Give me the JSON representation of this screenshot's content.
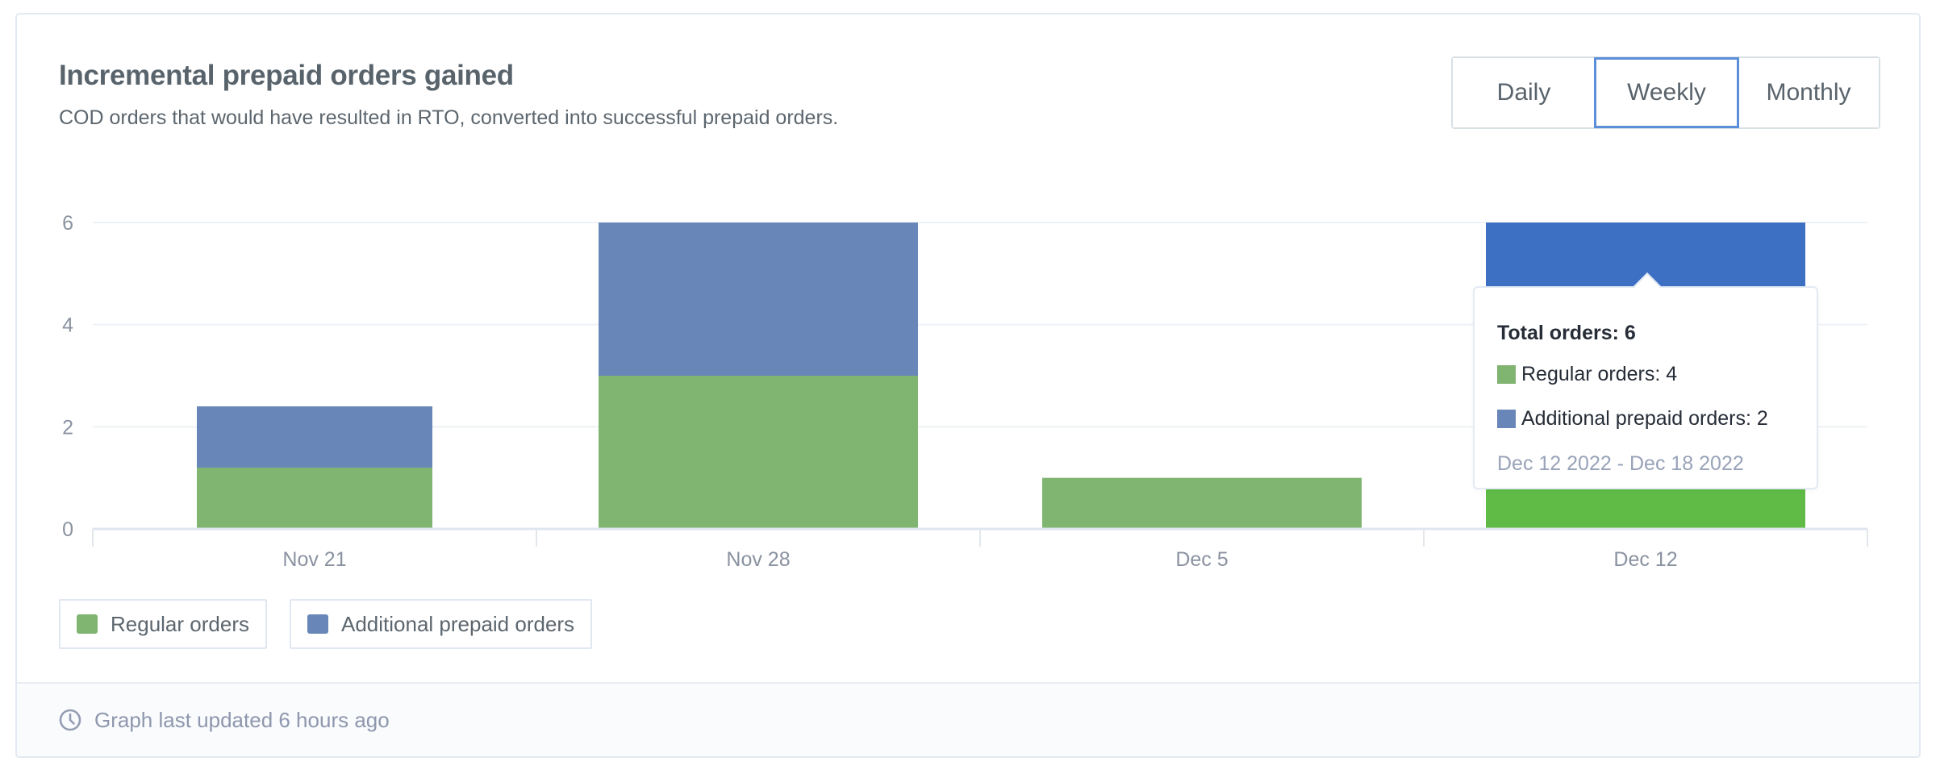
{
  "card": {
    "title": "Incremental prepaid orders gained",
    "subtitle": "COD orders that would have resulted in RTO, converted into successful prepaid orders."
  },
  "period_toggle": {
    "options": [
      {
        "label": "Daily",
        "active": false
      },
      {
        "label": "Weekly",
        "active": true
      },
      {
        "label": "Monthly",
        "active": false
      }
    ],
    "selected": "Weekly"
  },
  "colors": {
    "regular": "#80b471",
    "additional": "#6886b7",
    "regular_hover": "#5fbb46",
    "additional_hover": "#3d70c2",
    "active_border": "#5c8fd9"
  },
  "chart_data": {
    "type": "bar",
    "stacked": true,
    "title": "Incremental prepaid orders gained",
    "xlabel": "",
    "ylabel": "",
    "categories": [
      "Nov 21",
      "Nov 28",
      "Dec 5",
      "Dec 12"
    ],
    "series": [
      {
        "name": "Regular orders",
        "values": [
          1.2,
          3,
          1,
          4
        ]
      },
      {
        "name": "Additional prepaid orders",
        "values": [
          1.2,
          3,
          0,
          2
        ]
      }
    ],
    "ylim": [
      0,
      6
    ],
    "yticks": [
      "0",
      "2",
      "4",
      "6"
    ],
    "ytick_values": [
      0,
      2,
      4,
      6
    ],
    "grid": true,
    "legend": "bottom-left",
    "highlighted_category": "Dec 12"
  },
  "legend": {
    "items": [
      {
        "label": "Regular orders"
      },
      {
        "label": "Additional prepaid orders"
      }
    ]
  },
  "tooltip": {
    "title": "Total orders: 6",
    "rows": [
      {
        "label": "Regular orders: 4"
      },
      {
        "label": "Additional prepaid orders: 2"
      }
    ],
    "date_range": "Dec 12 2022 - Dec 18 2022"
  },
  "footer": {
    "icon": "clock-icon",
    "text": "Graph last updated 6 hours ago"
  }
}
